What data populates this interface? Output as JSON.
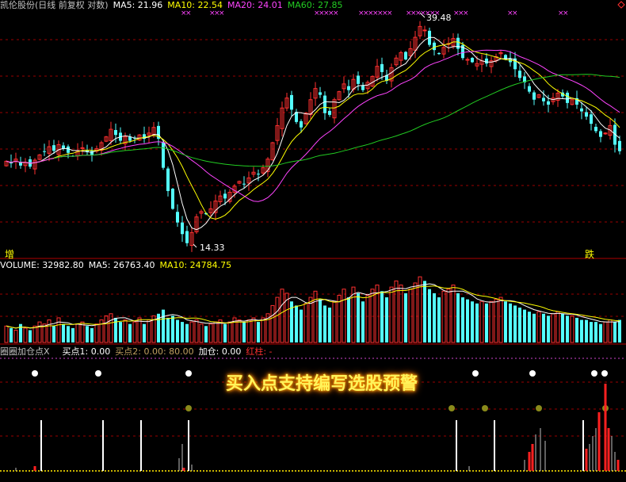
{
  "header": {
    "title": "凯伦股份(日线 前复权 对数)",
    "ma_labels": [
      "MA5: 21.96",
      "MA10: 22.54",
      "MA20: 24.01",
      "MA60: 27.85"
    ],
    "ma_colors": [
      "#ffffff",
      "#ffff00",
      "#ff44ff",
      "#22cc22"
    ]
  },
  "volume_header": {
    "labels": [
      "VOLUME: 32982.80",
      "MA5: 26763.40",
      "MA10: 24784.75"
    ],
    "colors": [
      "#ffffff",
      "#ffffff",
      "#ffff00"
    ]
  },
  "indicator_header": {
    "name": "圈圈加仓点X",
    "items": [
      {
        "text": "买点1: 0.00",
        "color": "#ffffff"
      },
      {
        "text": "买点2: 0.00",
        "color": "#c0a060"
      },
      {
        "text": ": 80.00",
        "color": "#c0a060"
      },
      {
        "text": "加仓: 0.00",
        "color": "#ffffff"
      },
      {
        "text": "红柱: -",
        "color": "#ff3030"
      }
    ]
  },
  "price_annotations": {
    "high": "39.48",
    "low": "14.33"
  },
  "corner_labels": {
    "left": "增",
    "right": "跌"
  },
  "banner": "买入点支持编写选股预警",
  "colors": {
    "up": "#ff3030",
    "down": "#54ffff",
    "frame": "#b00000",
    "grid": "#9a0000"
  },
  "chart_data": [
    {
      "type": "candlestick",
      "title": "凯伦股份(日线 前复权 对数)",
      "ylim": [
        14.33,
        39.48
      ],
      "scale": "log",
      "series": [
        {
          "name": "MA5",
          "last": 21.96
        },
        {
          "name": "MA10",
          "last": 22.54
        },
        {
          "name": "MA20",
          "last": 24.01
        },
        {
          "name": "MA60",
          "last": 27.85
        }
      ],
      "annotations": [
        {
          "text": "39.48",
          "type": "high"
        },
        {
          "text": "14.33",
          "type": "low"
        }
      ],
      "closes": [
        21.0,
        20.8,
        21.2,
        20.6,
        20.9,
        20.5,
        21.1,
        21.6,
        21.9,
        22.4,
        22.0,
        22.6,
        22.2,
        21.8,
        21.5,
        22.0,
        22.3,
        21.9,
        21.6,
        22.2,
        22.8,
        23.4,
        24.2,
        23.6,
        23.0,
        23.4,
        23.0,
        23.3,
        23.6,
        23.2,
        23.8,
        24.4,
        23.2,
        20.4,
        18.4,
        17.0,
        16.0,
        15.2,
        14.6,
        15.3,
        16.4,
        16.8,
        16.6,
        17.0,
        17.6,
        18.0,
        17.8,
        18.3,
        18.8,
        19.2,
        19.0,
        19.5,
        20.0,
        19.8,
        20.4,
        21.2,
        22.8,
        24.6,
        26.6,
        27.8,
        26.4,
        25.0,
        24.4,
        26.0,
        27.6,
        29.0,
        28.2,
        26.0,
        25.8,
        27.6,
        28.6,
        29.6,
        28.8,
        30.2,
        29.6,
        28.8,
        29.8,
        30.6,
        32.0,
        31.2,
        30.0,
        31.8,
        33.2,
        34.0,
        33.0,
        34.6,
        36.4,
        38.2,
        37.6,
        35.2,
        34.4,
        33.8,
        34.8,
        35.4,
        36.2,
        34.6,
        33.2,
        33.0,
        32.6,
        32.4,
        32.8,
        32.4,
        32.8,
        33.4,
        34.0,
        33.0,
        32.6,
        31.6,
        30.4,
        29.8,
        28.6,
        27.6,
        28.2,
        27.4,
        27.0,
        27.8,
        28.4,
        28.0,
        27.2,
        27.6,
        27.0,
        26.2,
        25.6,
        24.8,
        24.0,
        23.4,
        23.8,
        24.6,
        22.6,
        21.96
      ]
    },
    {
      "type": "bar",
      "title": "VOLUME",
      "series": [
        {
          "name": "VOLUME",
          "last": 32982.8
        },
        {
          "name": "MA5",
          "last": 26763.4
        },
        {
          "name": "MA10",
          "last": 24784.75
        }
      ],
      "values": [
        8,
        7,
        6,
        9,
        7,
        6,
        8,
        10,
        9,
        11,
        8,
        12,
        9,
        8,
        7,
        9,
        10,
        8,
        7,
        9,
        11,
        13,
        14,
        12,
        10,
        11,
        9,
        10,
        12,
        9,
        11,
        13,
        14,
        16,
        12,
        13,
        11,
        10,
        9,
        10,
        11,
        9,
        8,
        9,
        10,
        11,
        9,
        10,
        12,
        11,
        10,
        11,
        12,
        10,
        12,
        14,
        18,
        22,
        26,
        24,
        20,
        18,
        16,
        19,
        22,
        25,
        21,
        18,
        17,
        20,
        23,
        26,
        22,
        27,
        24,
        20,
        23,
        26,
        28,
        25,
        22,
        27,
        30,
        28,
        24,
        26,
        29,
        32,
        30,
        26,
        24,
        22,
        25,
        26,
        28,
        24,
        22,
        21,
        20,
        19,
        20,
        19,
        20,
        21,
        22,
        20,
        19,
        18,
        17,
        16,
        15,
        14,
        15,
        14,
        13,
        14,
        15,
        14,
        13,
        13,
        12,
        11,
        11,
        10,
        10,
        9,
        10,
        11,
        10,
        11
      ],
      "unit": "relative"
    },
    {
      "type": "bar",
      "title": "圈圈加仓点X",
      "series": [
        {
          "name": "买点1",
          "last": 0.0
        },
        {
          "name": "买点2",
          "last": 0.0
        },
        {
          "name": "",
          "last": 80.0
        },
        {
          "name": "加仓",
          "last": 0.0
        }
      ]
    }
  ]
}
